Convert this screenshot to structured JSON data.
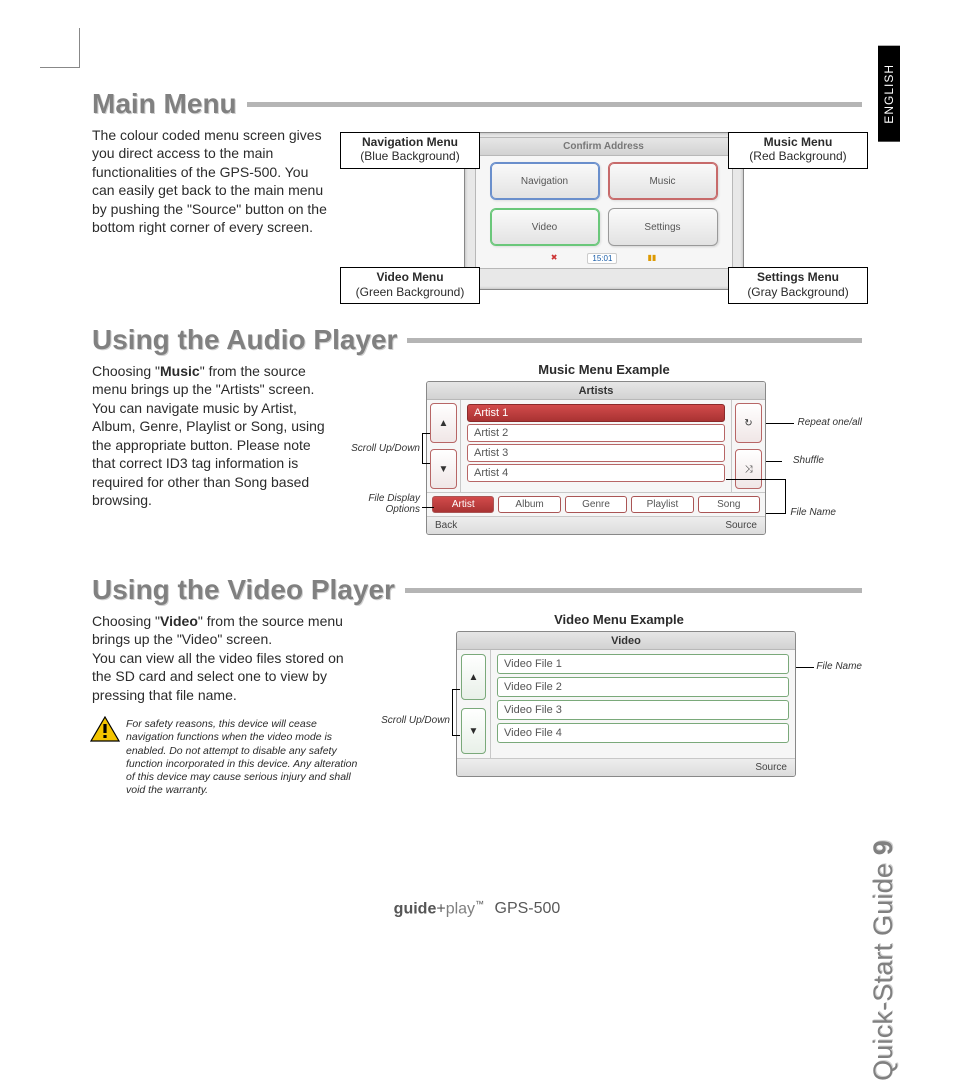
{
  "lang_tab": "ENGLISH",
  "side": {
    "page_num": "9",
    "title": "Quick-Start Guide"
  },
  "footer": {
    "brand1": "guide",
    "plus": "+",
    "brand2": "play",
    "tm": "™",
    "model": "GPS-500"
  },
  "s1": {
    "heading": "Main Menu",
    "body": "The colour coded menu screen gives you direct access to the main functionalities of the GPS-500. You can easily get back to the main menu by pushing the \"Source\" button on the bottom right corner of every screen.",
    "device_title": "Confirm Address",
    "buttons": {
      "nav": "Navigation",
      "music": "Music",
      "video": "Video",
      "settings": "Settings"
    },
    "status": {
      "left": "✖",
      "time": "15:01",
      "right": "▮▮"
    },
    "callouts": {
      "tl_title": "Navigation Menu",
      "tl_sub": "(Blue Background)",
      "tr_title": "Music Menu",
      "tr_sub": "(Red Background)",
      "bl_title": "Video Menu",
      "bl_sub": "(Green Background)",
      "br_title": "Settings Menu",
      "br_sub": "(Gray Background)"
    }
  },
  "s2": {
    "heading": "Using the Audio Player",
    "body_intro": "Choosing  \"",
    "body_bold": "Music",
    "body_rest": "\" from the source menu brings up the \"Artists\" screen.\nYou can navigate music by Artist, Album, Genre, Playlist or Song, using the appropriate button. Please note that correct ID3 tag information is required for other than Song based browsing.",
    "subhead": "Music Menu Example",
    "device_title": "Artists",
    "list": [
      "Artist 1",
      "Artist 2",
      "Artist 3",
      "Artist 4"
    ],
    "tabs": [
      "Artist",
      "Album",
      "Genre",
      "Playlist",
      "Song"
    ],
    "bottom_left": "Back",
    "bottom_right": "Source",
    "right_icons": {
      "repeat": "↻",
      "shuffle": "⤨"
    },
    "annos": {
      "scroll": "Scroll Up/Down",
      "file_display": "File Display\nOptions",
      "repeat": "Repeat one/all",
      "shuffle": "Shuffle",
      "filename": "File Name"
    }
  },
  "s3": {
    "heading": "Using the Video Player",
    "body_intro": "Choosing  \"",
    "body_bold": "Video",
    "body_rest": "\" from the source menu brings up the  \"Video\" screen.\nYou can view all the video files stored on the SD card and select one to view by pressing that file name.",
    "subhead": "Video Menu Example",
    "device_title": "Video",
    "list": [
      "Video File 1",
      "Video File 2",
      "Video File 3",
      "Video File 4"
    ],
    "bottom_right": "Source",
    "annos": {
      "scroll": "Scroll Up/Down",
      "filename": "File Name"
    },
    "warning": "For safety reasons, this device will cease navigation functions when the video mode is enabled.  Do not attempt to disable any safety function incorporated in this device.  Any alteration of this device may cause serious injury and shall void the warranty."
  }
}
